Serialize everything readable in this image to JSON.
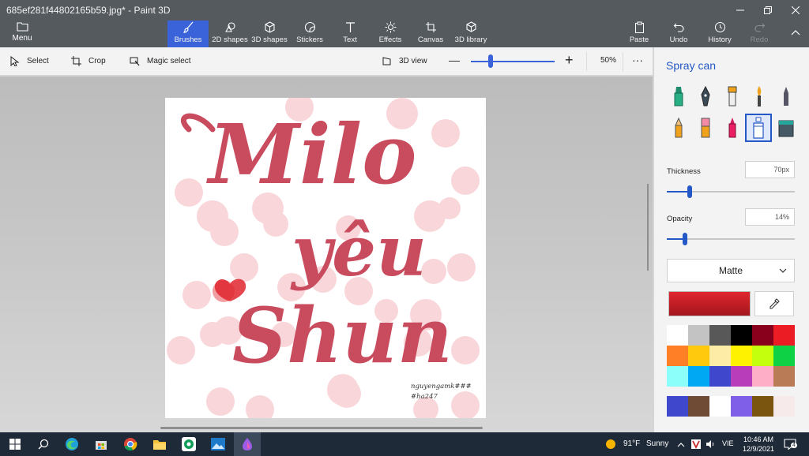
{
  "window": {
    "title": "685ef281f44802165b59.jpg* - Paint 3D"
  },
  "ribbon": {
    "menu_label": "Menu",
    "tabs": [
      {
        "label": "Brushes",
        "icon": "brush-icon",
        "active": true
      },
      {
        "label": "2D shapes",
        "icon": "2d-shapes-icon"
      },
      {
        "label": "3D shapes",
        "icon": "3d-cube-icon"
      },
      {
        "label": "Stickers",
        "icon": "stickers-icon"
      },
      {
        "label": "Text",
        "icon": "text-icon"
      },
      {
        "label": "Effects",
        "icon": "effects-icon"
      },
      {
        "label": "Canvas",
        "icon": "canvas-icon"
      },
      {
        "label": "3D library",
        "icon": "3d-library-icon"
      }
    ],
    "actions": [
      {
        "label": "Paste",
        "icon": "paste-icon"
      },
      {
        "label": "Undo",
        "icon": "undo-icon"
      },
      {
        "label": "History",
        "icon": "history-icon"
      },
      {
        "label": "Redo",
        "icon": "redo-icon",
        "disabled": true
      }
    ]
  },
  "toolbar": {
    "select_label": "Select",
    "crop_label": "Crop",
    "magic_select_label": "Magic select",
    "view3d_label": "3D view",
    "zoom_minus": "—",
    "zoom_plus": "+",
    "zoom_value": "50%",
    "more": "···"
  },
  "canvas": {
    "lines": [
      "Milo",
      "yêu",
      "Shun"
    ],
    "watermark_line1": "nguyengamk###",
    "watermark_line2": "#ha247",
    "text_color": "#c94b5e"
  },
  "panel": {
    "title": "Spray can",
    "thickness_label": "Thickness",
    "thickness_value": "70px",
    "thickness_fraction": 0.18,
    "opacity_label": "Opacity",
    "opacity_value": "14%",
    "opacity_fraction": 0.14,
    "texture_value": "Matte",
    "current_color": "#e0262e",
    "palette": [
      "#ffffff",
      "#c3c3c3",
      "#585858",
      "#000000",
      "#88001b",
      "#ec1c24",
      "#ff7f27",
      "#ffc90e",
      "#fdeca6",
      "#fff200",
      "#c4ff0e",
      "#0ed145",
      "#8cfffb",
      "#00a8f3",
      "#3f48cc",
      "#b83dba",
      "#ffaec8",
      "#b97a56"
    ],
    "custom_colors": [
      "#3f48cc",
      "#6f4a35",
      "#ffffff",
      "#7f5fe8",
      "#7a5510",
      "#f6ebea"
    ]
  },
  "taskbar": {
    "weather_temp": "91°F",
    "weather_text": "Sunny",
    "lang": "VIE",
    "time": "10:46 AM",
    "date": "12/9/2021",
    "notif_count": "4"
  }
}
